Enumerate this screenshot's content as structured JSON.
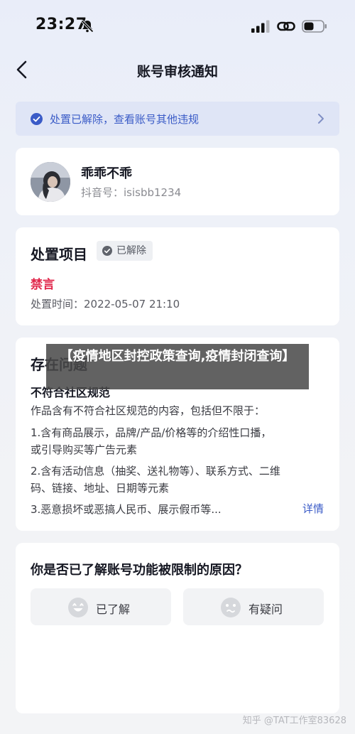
{
  "status_bar": {
    "time": "23:27",
    "icons": [
      "bell-slash-icon",
      "signal-icon",
      "link-icon",
      "battery-icon"
    ]
  },
  "nav": {
    "title": "账号审核通知",
    "back_icon": "chevron-left-icon"
  },
  "notice": {
    "text": "处置已解除，查看账号其他违规",
    "icon": "check-circle-icon",
    "accent": "#3a5bc7"
  },
  "user": {
    "name": "乖乖不乖",
    "id_label": "抖音号：isisbb1234"
  },
  "action": {
    "title": "处置项目",
    "status": "已解除",
    "ban_type": "禁言",
    "time": "处置时间：2022-05-07 21:10",
    "ban_color": "#e1274b"
  },
  "problem": {
    "title": "存在问题",
    "name": "不符合社区规范",
    "lines": [
      "作品含有不符合社区规范的内容，包括但不限于：",
      "1.含有商品展示，品牌/产品/价格等的介绍性口播，",
      "或引导购买等广告元素",
      "2.含有活动信息（抽奖、送礼物等）、联系方式、二维",
      "码、链接、地址、日期等元素",
      "3.恶意损坏或恶搞人民币、展示假币等..."
    ],
    "detail_link": "详情"
  },
  "reason": {
    "question": "你是否已了解账号功能被限制的原因？",
    "answers": [
      {
        "label": "已了解",
        "icon": "happy-face-icon"
      },
      {
        "label": "有疑问",
        "icon": "confused-face-icon"
      }
    ]
  },
  "overlay": {
    "text": "【疫情地区封控政策查询,疫情封闭查询】"
  },
  "watermark": "知乎 @TAT工作室83628"
}
